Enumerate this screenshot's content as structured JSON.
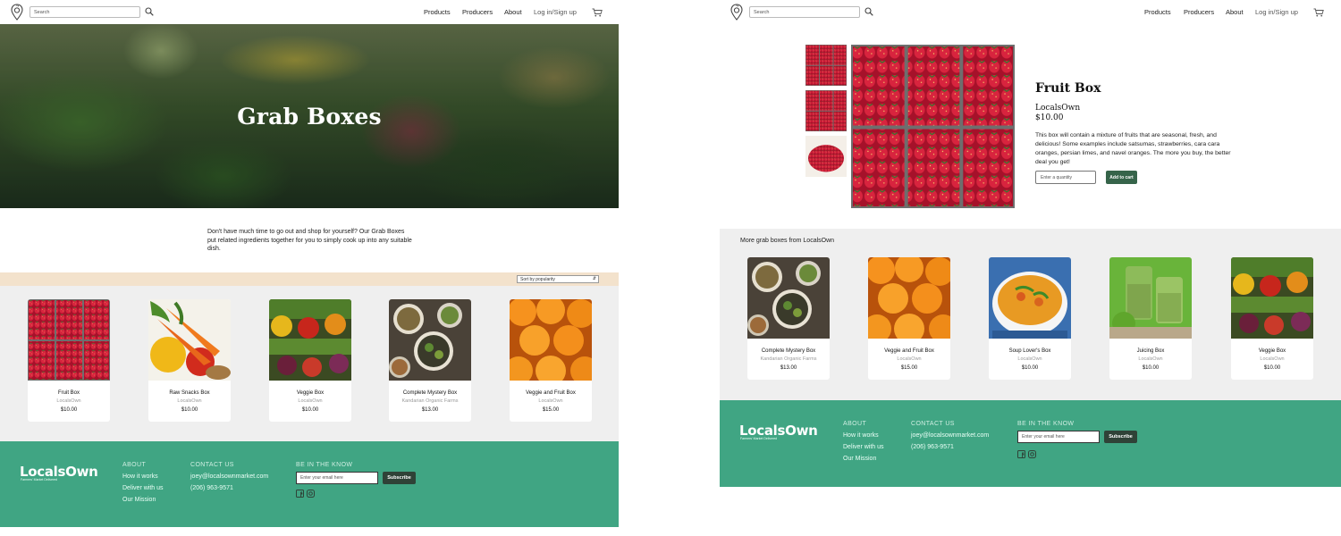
{
  "header": {
    "search_placeholder": "Search",
    "nav": {
      "products": "Products",
      "producers": "Producers",
      "about": "About",
      "login": "Log in/Sign up"
    }
  },
  "listing": {
    "hero_title": "Grab Boxes",
    "intro": "Don't have much time to go out and shop for yourself? Our Grab Boxes put related ingredients together for you to simply cook up into any suitable dish.",
    "sort_label": "Sort by popularity",
    "products": [
      {
        "name": "Fruit Box",
        "producer": "LocalsOwn",
        "price": "$10.00",
        "image": "strawberries"
      },
      {
        "name": "Raw Snacks Box",
        "producer": "LocalsOwn",
        "price": "$10.00",
        "image": "carrots-peppers"
      },
      {
        "name": "Veggie Box",
        "producer": "LocalsOwn",
        "price": "$10.00",
        "image": "vegetables"
      },
      {
        "name": "Complete Mystery Box",
        "producer": "Kandarian Organic Farms",
        "price": "$13.00",
        "image": "dinner-bowls"
      },
      {
        "name": "Veggie and Fruit Box",
        "producer": "LocalsOwn",
        "price": "$15.00",
        "image": "oranges"
      }
    ]
  },
  "detail": {
    "title": "Fruit Box",
    "producer": "LocalsOwn",
    "price": "$10.00",
    "description": "This box will contain a mixture of fruits that are seasonal, fresh, and delicious! Some examples include satsumas, strawberries, cara cara oranges, persian limes, and navel oranges. The more you buy, the better deal you get!",
    "quantity_placeholder": "Enter a quantity",
    "add_to_cart": "Add to cart",
    "more_title": "More grab boxes from LocalsOwn",
    "more": [
      {
        "name": "Complete Mystery Box",
        "producer": "Kandarian Organic Farms",
        "price": "$13.00",
        "image": "dinner-bowls"
      },
      {
        "name": "Veggie and Fruit Box",
        "producer": "LocalsOwn",
        "price": "$15.00",
        "image": "oranges"
      },
      {
        "name": "Soup Lover's Box",
        "producer": "LocalsOwn",
        "price": "$10.00",
        "image": "soup"
      },
      {
        "name": "Juicing Box",
        "producer": "LocalsOwn",
        "price": "$10.00",
        "image": "green-juice"
      },
      {
        "name": "Veggie Box",
        "producer": "LocalsOwn",
        "price": "$10.00",
        "image": "vegetables"
      }
    ]
  },
  "footer": {
    "logo": "LocalsOwn",
    "tagline": "Farmers' Market Delivered",
    "about_heading": "ABOUT",
    "about_links": [
      "How it works",
      "Deliver with us",
      "Our Mission"
    ],
    "contact_heading": "CONTACT US",
    "email": "joey@localsownmarket.com",
    "phone": "(206) 963-9571",
    "newsletter_heading": "BE IN THE KNOW",
    "email_placeholder": "Enter your email here",
    "subscribe": "Subscribe"
  },
  "colors": {
    "footer_green": "#40a583",
    "sort_bar": "#f3e2cc",
    "add_to_cart": "#36644a",
    "subscribe": "#2f4237"
  }
}
